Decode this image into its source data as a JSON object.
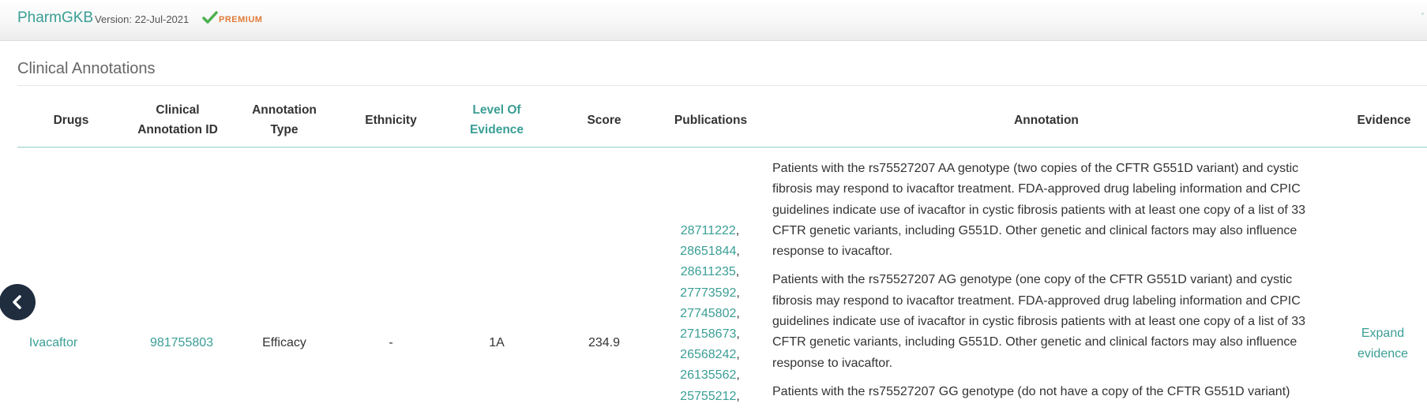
{
  "header": {
    "brand": "PharmGKB",
    "version_text": "Version: 22-Jul-2021",
    "premium_label": "PREMIUM"
  },
  "section": {
    "title": "Clinical Annotations"
  },
  "table": {
    "columns": [
      "Drugs",
      "Clinical Annotation ID",
      "Annotation Type",
      "Ethnicity",
      "Level Of Evidence",
      "Score",
      "Publications",
      "Annotation",
      "Evidence"
    ],
    "row": {
      "drug": "Ivacaftor",
      "clinical_annotation_id": "981755803",
      "annotation_type": "Efficacy",
      "ethnicity": "-",
      "level_of_evidence": "1A",
      "score": "234.9",
      "publications": [
        "28711222",
        "28651844",
        "28611235",
        "27773592",
        "27745802",
        "27158673",
        "26568242",
        "26135562",
        "25755212"
      ],
      "annotations": [
        "Patients with the rs75527207 AA genotype (two copies of the CFTR G551D variant) and cystic fibrosis may respond to ivacaftor treatment. FDA-approved drug labeling information and CPIC guidelines indicate use of ivacaftor in cystic fibrosis patients with at least one copy of a list of 33 CFTR genetic variants, including G551D. Other genetic and clinical factors may also influence response to ivacaftor.",
        "Patients with the rs75527207 AG genotype (one copy of the CFTR G551D variant) and cystic fibrosis may respond to ivacaftor treatment. FDA-approved drug labeling information and CPIC guidelines indicate use of ivacaftor in cystic fibrosis patients with at least one copy of a list of 33 CFTR genetic variants, including G551D. Other genetic and clinical factors may also influence response to ivacaftor.",
        "Patients with the rs75527207 GG genotype (do not have a copy of the CFTR G551D variant)"
      ],
      "evidence_link": "Expand evidence"
    }
  },
  "colors": {
    "accent": "#3a9e95",
    "premium": "#e07b39",
    "nav_button": "#1f2d3f"
  },
  "icons": {
    "premium": "check-icon",
    "nav": "chevron-left-icon"
  }
}
